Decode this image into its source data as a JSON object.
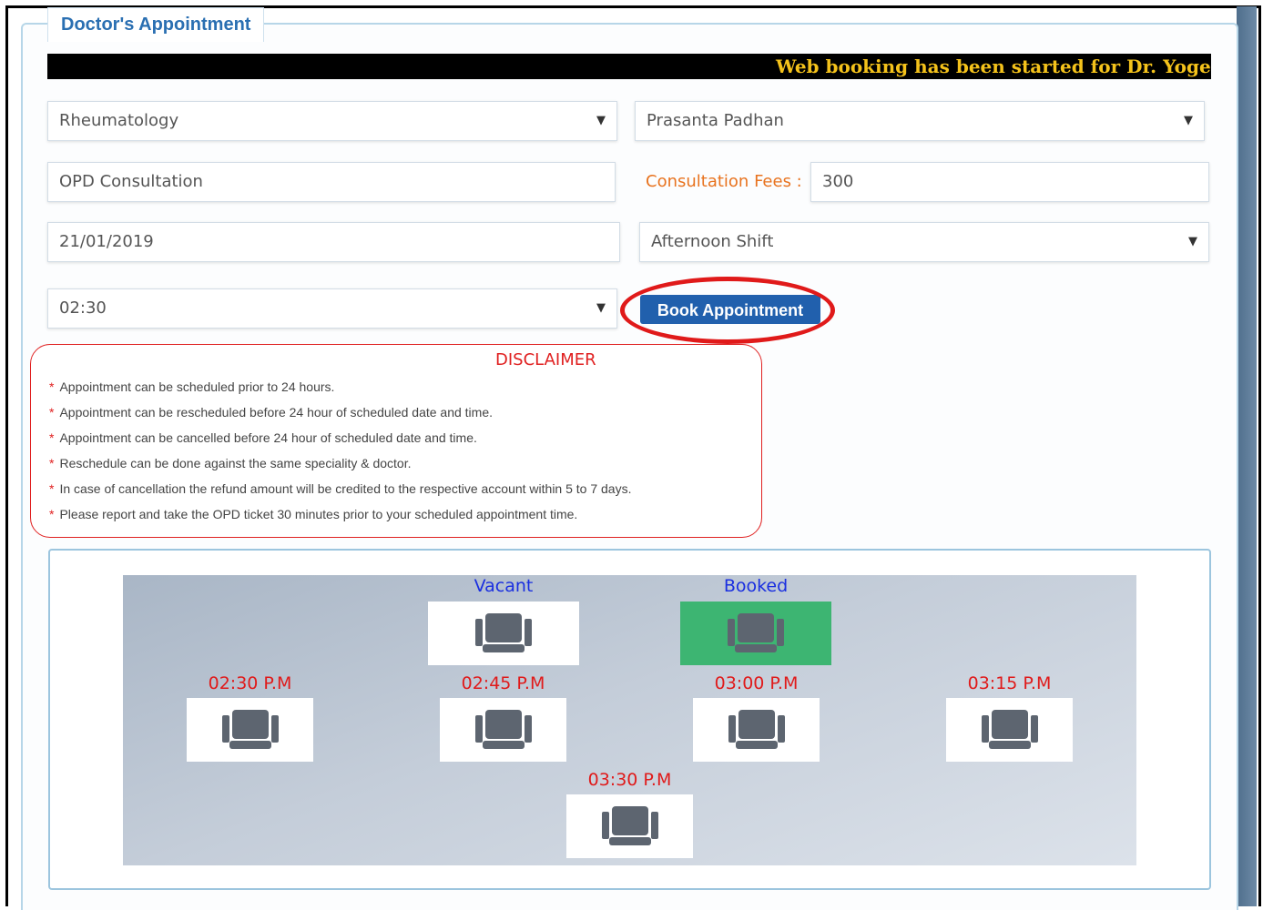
{
  "legend": "Doctor's Appointment",
  "marquee": "Web booking has been started for Dr. Yogesh K",
  "form": {
    "speciality": "Rheumatology",
    "doctor": "Prasanta Padhan",
    "consultation_type": "OPD Consultation",
    "fee_label": "Consultation Fees :",
    "fee_value": "300",
    "date": "21/01/2019",
    "shift": "Afternoon Shift",
    "time": "02:30",
    "book_button": "Book Appointment"
  },
  "disclaimer": {
    "title": "DISCLAIMER",
    "items": [
      "Appointment can be scheduled prior to 24 hours.",
      "Appointment can be rescheduled before 24 hour of scheduled date and time.",
      "Appointment can be cancelled before 24 hour of scheduled date and time.",
      "Reschedule can be done against the same speciality & doctor.",
      "In case of cancellation the refund amount will be credited to the respective account within 5 to 7 days.",
      "Please report and take the OPD ticket 30 minutes prior to your scheduled appointment time."
    ]
  },
  "seat_legend": {
    "vacant": "Vacant",
    "booked": "Booked"
  },
  "slots": [
    "02:30 P.M",
    "02:45 P.M",
    "03:00 P.M",
    "03:15 P.M",
    "03:30 P.M"
  ],
  "colors": {
    "accent": "#2160ad",
    "booked": "#3db572",
    "highlight": "#e01a1a",
    "marquee_text": "#f4c21b"
  }
}
